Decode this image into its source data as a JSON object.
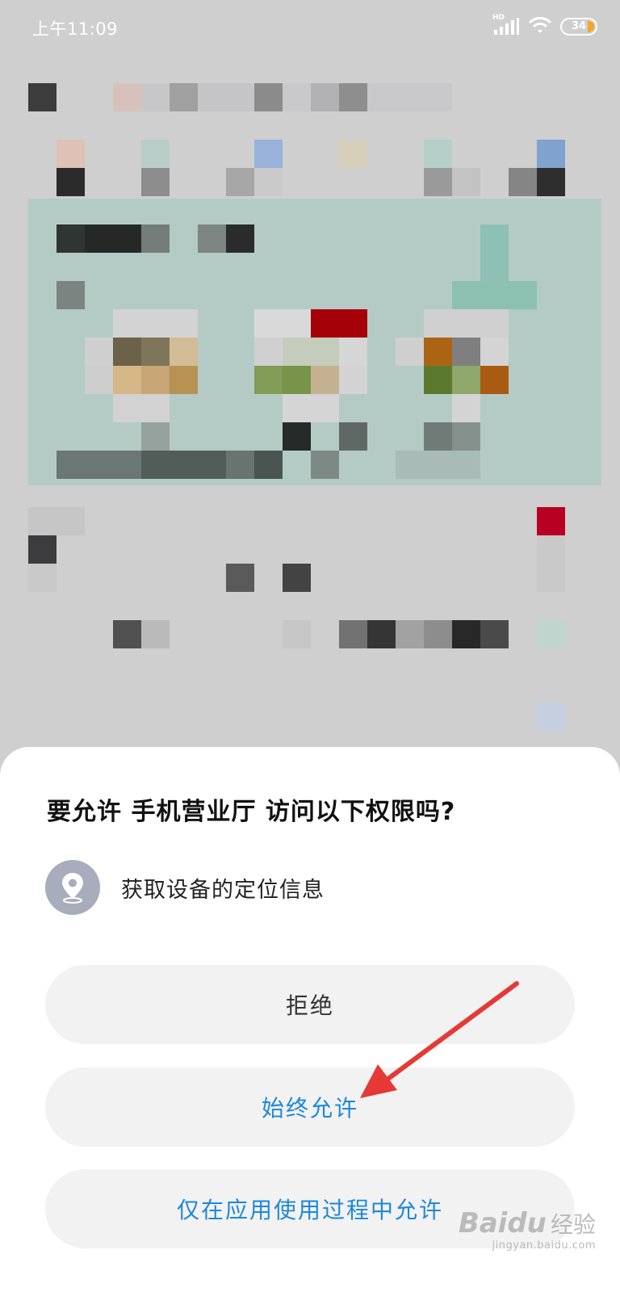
{
  "status_bar": {
    "time": "上午11:09",
    "network_label": "HD",
    "battery_level": "34",
    "icons": [
      "signal-icon",
      "wifi-icon",
      "battery-icon"
    ]
  },
  "dialog": {
    "title": "要允许 手机营业厅 访问以下权限吗?",
    "permission": {
      "icon": "location-icon",
      "label": "获取设备的定位信息"
    },
    "buttons": {
      "deny": "拒绝",
      "always_allow": "始终允许",
      "allow_while_using": "仅在应用使用过程中允许"
    }
  },
  "watermark": {
    "logo": "Baidu",
    "name": "经验",
    "url": "jingyan.baidu.com"
  },
  "colors": {
    "accent": "#1e88d9",
    "button_bg": "#f2f2f2",
    "annotation_arrow": "#e53935"
  }
}
